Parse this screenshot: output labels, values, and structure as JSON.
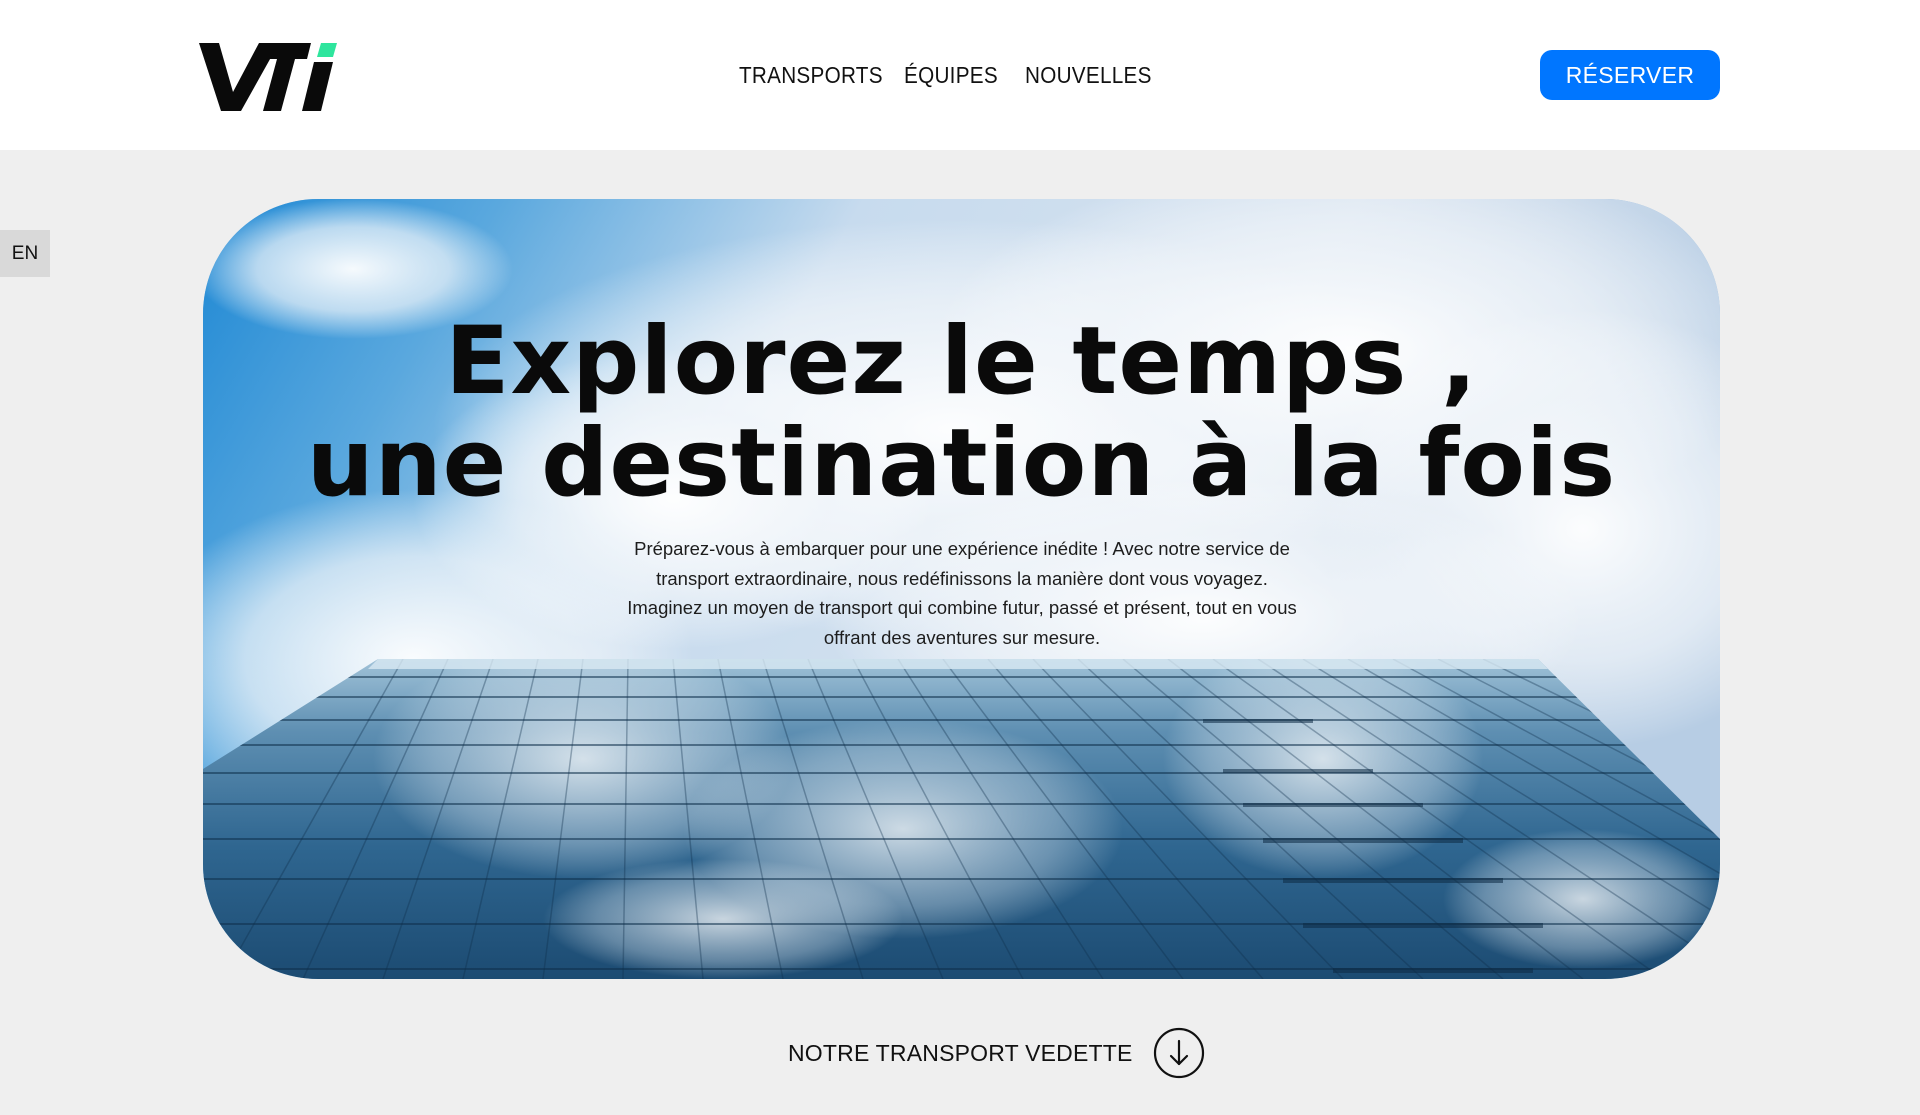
{
  "header": {
    "logo_text": "VTi",
    "nav": [
      {
        "label": "TRANSPORTS"
      },
      {
        "label": "ÉQUIPES"
      },
      {
        "label": "NOUVELLES"
      }
    ],
    "cta_label": "RÉSERVER"
  },
  "language_toggle": "EN",
  "hero": {
    "title_line1": "Explorez le temps ,",
    "title_line2": "une destination à la fois",
    "description": "Préparez-vous à embarquer pour une expérience inédite ! Avec notre service de transport extraordinaire, nous redéfinissons la manière dont vous voyagez. Imaginez un moyen de transport qui combine futur, passé et présent, tout en vous offrant des aventures sur mesure."
  },
  "featured": {
    "label": "NOTRE TRANSPORT VEDETTE",
    "icon": "arrow-down-circle-icon"
  },
  "colors": {
    "accent": "#0076ff",
    "logo_accent": "#2ee59d",
    "page_background": "#efefef",
    "header_background": "#ffffff"
  }
}
